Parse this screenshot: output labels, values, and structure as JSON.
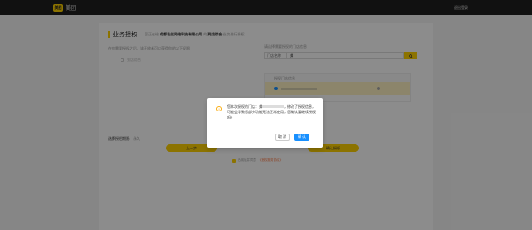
{
  "topbar": {
    "logo_badge": "美团",
    "logo_text": "美团",
    "right_link": "退出登录"
  },
  "page": {
    "title": "业务授权",
    "subtitle_prefix": "您正在给",
    "company": "成都花丝网络科技有限公司",
    "subtitle_mid": "的",
    "business": "到店综合",
    "subtitle_suffix": "业务进行授权",
    "left_desc": "在你需要授权之后，该开放者可以获得你的以下权限",
    "left_checkbox": "到店综合",
    "right_desc": "请选择需要授权的门店信息",
    "search_select": "门店名称",
    "search_value": "美",
    "list_header": "授权门店信息",
    "period_label": "选择授权期限:",
    "period_value": "永久",
    "prev_button": "上一步",
    "confirm_button": "确认授权",
    "agree_text": "已阅读并同意",
    "agree_link": "《授权服务协议》"
  },
  "modal": {
    "text_1": "您本次授权的门店：美",
    "text_2": "，修改了授权信息，可能会导致您部分功能无法正常使用，您确认要继续授权吗?",
    "cancel": "取 消",
    "ok": "确 认"
  }
}
